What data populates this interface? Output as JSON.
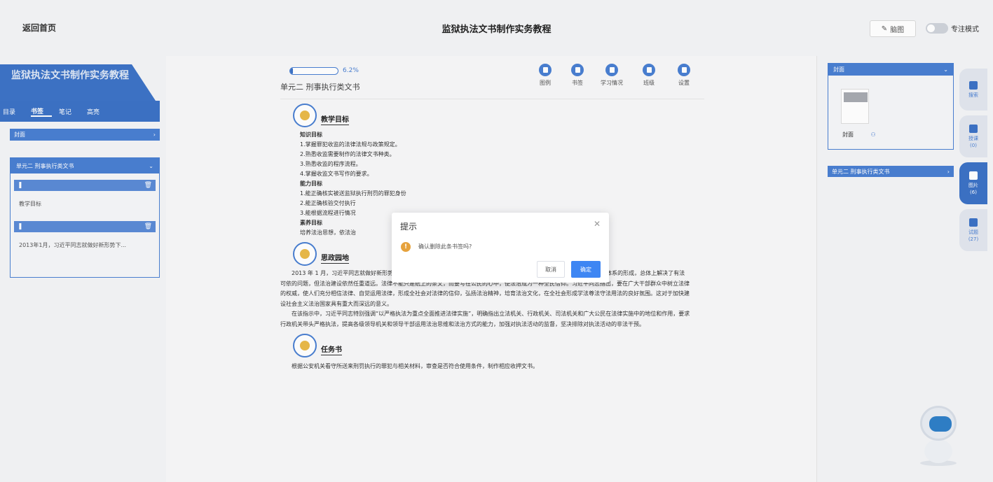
{
  "header": {
    "back_label": "返回首页",
    "book_title": "监狱执法文书制作实务教程",
    "mindmap_label": "脑图",
    "focus_mode_label": "专注模式"
  },
  "left": {
    "banner_title": "监狱执法文书制作实务教程",
    "tabs": [
      "目录",
      "书签",
      "笔记",
      "高亮"
    ],
    "active_tab": "书签",
    "cover_label": "封面",
    "unit_label": "单元二 刑事执行类文书",
    "bookmarks": [
      {
        "text": "教学目标"
      },
      {
        "text": "2013年1月，习近平同志就做好新形势下..."
      }
    ]
  },
  "main": {
    "progress_text": "6.2%",
    "progress_value": 0.062,
    "unit_title": "单元二 刑事执行类文书",
    "tools": [
      "图例",
      "书签",
      "学习情况",
      "班级",
      "设置"
    ],
    "sections": {
      "s1_title": "教学目标",
      "knowledge_head": "知识目标",
      "k1": "1.掌握罪犯收监的法律法规与政策规定。",
      "k2": "2.熟悉收监需要制作的法律文书种类。",
      "k3": "3.熟悉收监的程序流程。",
      "k4": "4.掌握收监文书写作的要求。",
      "ability_head": "能力目标",
      "a1": "1.能正确核实被送监狱执行刑罚的罪犯身份",
      "a2": "2.能正确核验交付执行",
      "a3": "3.能根据流程进行情况",
      "quality_head": "素养目标",
      "q1": "培养法治思想，依法治",
      "s2_title": "思政园地",
      "p1": "2013 年 1 月，习近平同志就做好新形势下政法工作做出重要指示，首次提出建设法治中国的宏伟目标。中国特色社会主义法律体系的形成，总体上解决了有法可依的问题，但法治建设依然任重道远。法律不能只是纸上的条文，而要写在公民的心中，使法治成为一种全民信仰。习近平同志指出，要在广大干部群众中树立法律的权威，使人们充分相信法律、自觉运用法律，形成全社会对法律的信仰，弘扬法治精神，培育法治文化，在全社会形成学法尊法守法用法的良好氛围。这对于加快建设社会主义法治国家具有重大而深远的意义。",
      "p2": "在该指示中，习近平同志特别强调“以严格执法为重点全面推进法律实施”，明确指出立法机关、行政机关、司法机关和广大公民在法律实施中的地位和作用，要求行政机关带头严格执法，提高各级领导机关和领导干部运用法治思维和法治方式的能力，加强对执法活动的监督，坚决排除对执法活动的非法干预。",
      "s3_title": "任务书",
      "p3": "根据公安机关看守所送来刑罚执行的罪犯与相关材料，审查是否符合使用条件，制作相应收押文书。"
    }
  },
  "right": {
    "cover_label": "封面",
    "cover_caption": "封面",
    "unit_label": "单元二 刑事执行类文书",
    "side_tabs": [
      {
        "label": "搜索",
        "count": ""
      },
      {
        "label": "授课",
        "count": "(0)"
      },
      {
        "label": "图片",
        "count": "(6)"
      },
      {
        "label": "试题",
        "count": "(27)"
      }
    ]
  },
  "dialog": {
    "title": "提示",
    "message": "确认删除此条书签吗?",
    "cancel_label": "取消",
    "confirm_label": "确定",
    "icon": "warning-icon"
  },
  "colors": {
    "primary": "#3c72c6",
    "confirm": "#3e86f3",
    "warning": "#e6a23c"
  }
}
